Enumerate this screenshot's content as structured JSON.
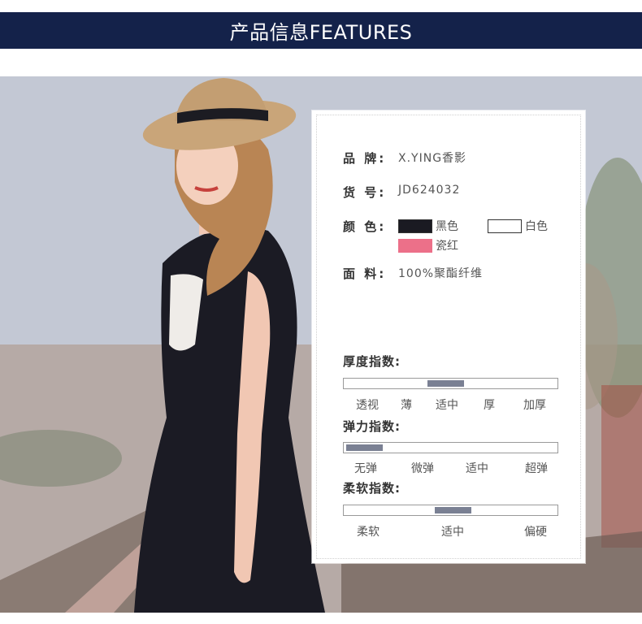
{
  "header": {
    "title": "产品信息FEATURES"
  },
  "colors": {
    "header_bg": "#14224a",
    "gauge_fill": "#7a8093",
    "swatch_black": "#1a1a22",
    "swatch_white": "#ffffff",
    "swatch_pink": "#ec7089"
  },
  "specs": {
    "brand_label": "品  牌:",
    "brand_value": "X.YING香影",
    "sku_label": "货  号:",
    "sku_value": "JD624032",
    "color_label": "颜  色:",
    "color_options": [
      {
        "name": "黑色",
        "swatch": "#1a1a22"
      },
      {
        "name": "白色",
        "swatch": "#ffffff"
      },
      {
        "name": "瓷红",
        "swatch": "#ec7089"
      }
    ],
    "fabric_label": "面  料:",
    "fabric_value": "100%聚酯纤维"
  },
  "gauges": [
    {
      "title": "厚度指数:",
      "labels": [
        "透视",
        "薄",
        "适中",
        "厚",
        "加厚"
      ],
      "level": "适中"
    },
    {
      "title": "弹力指数:",
      "labels": [
        "无弹",
        "微弹",
        "适中",
        "超弹"
      ],
      "level": "无弹"
    },
    {
      "title": "柔软指数:",
      "labels": [
        "柔软",
        "适中",
        "偏硬"
      ],
      "level": "适中"
    }
  ],
  "photo": {
    "subject": "model-photo"
  }
}
